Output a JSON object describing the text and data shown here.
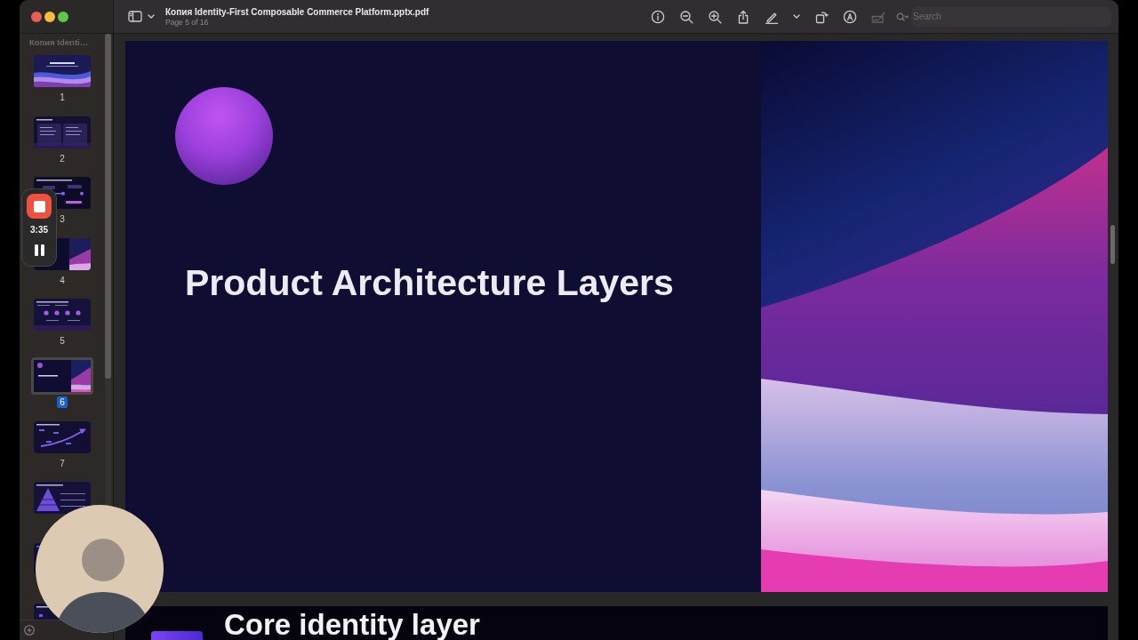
{
  "window": {
    "title": "Копия Identity-First Composable Commerce Platform.pptx.pdf",
    "subtitle": "Page 5 of 16"
  },
  "toolbar": {
    "tools": [
      {
        "kind": "info",
        "disabled": false
      },
      {
        "kind": "zoomout",
        "disabled": false
      },
      {
        "kind": "zoomin",
        "disabled": false
      },
      {
        "kind": "share",
        "disabled": false
      },
      {
        "kind": "markup",
        "disabled": false
      },
      {
        "kind": "rotate",
        "disabled": false
      },
      {
        "kind": "annotate",
        "disabled": false
      },
      {
        "kind": "sign",
        "disabled": true
      }
    ],
    "search": {
      "placeholder": "Search"
    }
  },
  "sidebar": {
    "title": "Копия Identi…",
    "thumbnails": [
      {
        "kind": "cover",
        "label": "1",
        "selected": false
      },
      {
        "kind": "columns",
        "label": "2",
        "selected": false
      },
      {
        "kind": "flow",
        "label": "3",
        "selected": false
      },
      {
        "kind": "hero",
        "label": "4",
        "selected": false
      },
      {
        "kind": "steps",
        "label": "5",
        "selected": false
      },
      {
        "kind": "title",
        "label": "6",
        "selected": true
      },
      {
        "kind": "roadmap",
        "label": "7",
        "selected": false
      },
      {
        "kind": "pyramid",
        "selected": false
      },
      {
        "kind": "plain",
        "selected": false
      },
      {
        "kind": "panels",
        "selected": false
      }
    ]
  },
  "slides": [
    {
      "kind": "title",
      "title": "Product Architecture Layers"
    },
    {
      "kind": "section",
      "title": "Core identity layer"
    }
  ],
  "recording": {
    "time": "3:35"
  }
}
